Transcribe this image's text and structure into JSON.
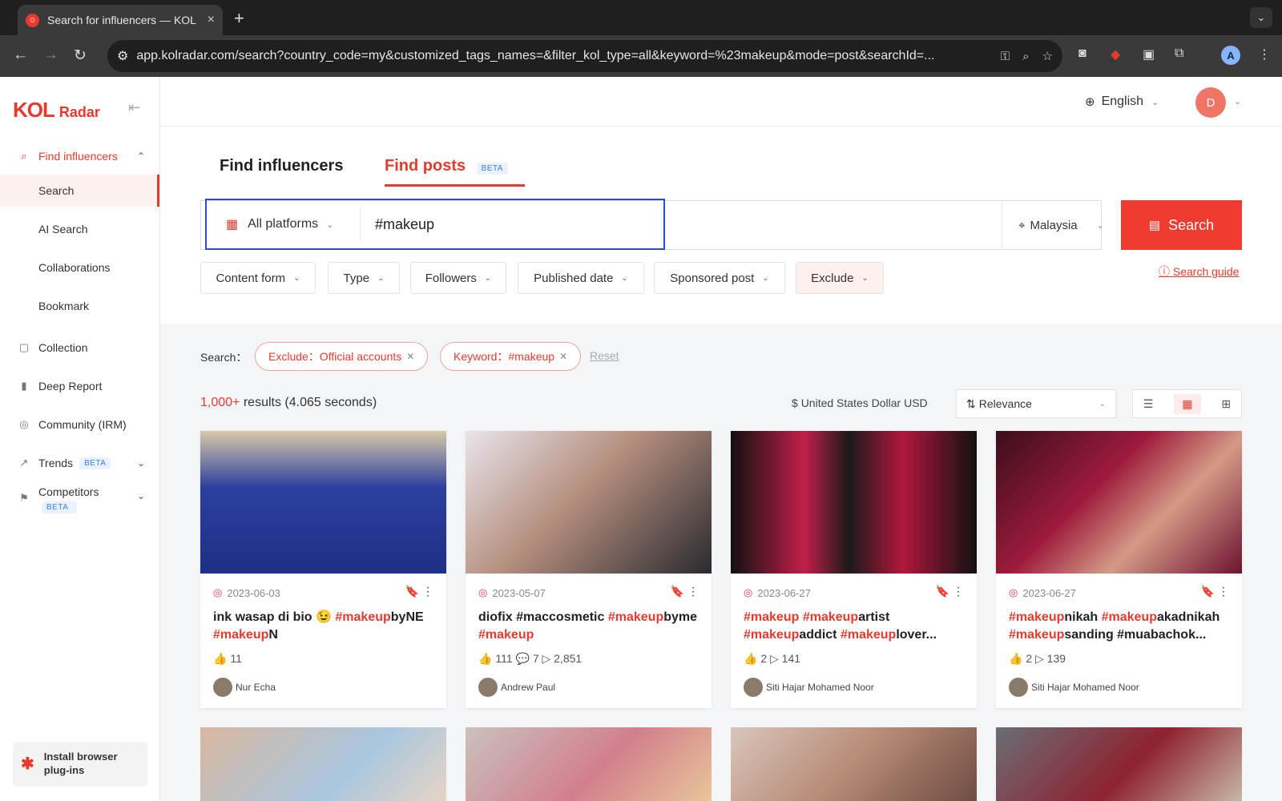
{
  "browser": {
    "tab_title": "Search for influencers — KOL",
    "url": "app.kolradar.com/search?country_code=my&customized_tags_names=&filter_kol_type=all&keyword=%23makeup&mode=post&searchId=..."
  },
  "sidebar": {
    "logo_main": "KOL",
    "logo_sub": "Radar",
    "items": [
      {
        "label": "Find influencers",
        "icon": "search-icon"
      },
      {
        "label": "Search"
      },
      {
        "label": "AI Search"
      },
      {
        "label": "Collaborations"
      },
      {
        "label": "Bookmark"
      },
      {
        "label": "Collection",
        "icon": "collection-icon"
      },
      {
        "label": "Deep Report",
        "icon": "chart-icon"
      },
      {
        "label": "Community (IRM)",
        "icon": "community-icon"
      },
      {
        "label": "Trends",
        "icon": "trend-icon",
        "badge": "BETA"
      },
      {
        "label": "Competitors",
        "icon": "flag-icon",
        "badge": "BETA"
      }
    ],
    "plugin_label_1": "Install browser",
    "plugin_label_2": "plug-ins"
  },
  "header": {
    "language": "English",
    "avatar_initial": "D"
  },
  "search": {
    "tab_influencers": "Find influencers",
    "tab_posts": "Find posts",
    "tab_posts_badge": "BETA",
    "platform": "All platforms",
    "keyword": "#makeup",
    "country": "Malaysia",
    "button": "Search",
    "filters": [
      "Content form",
      "Type",
      "Followers",
      "Published date",
      "Sponsored post",
      "Exclude"
    ],
    "guide": "Search guide"
  },
  "results": {
    "chips_label": "Search：",
    "chips": [
      "Exclude：Official accounts",
      "Keyword：#makeup"
    ],
    "reset": "Reset",
    "count": "1,000+",
    "count_suffix": " results (4.065 seconds)",
    "currency": "United States Dollar USD",
    "sort": "Relevance"
  },
  "posts": [
    {
      "date": "2023-06-03",
      "caption": "ink wasap di bio 😉 #makeupbyNE #makeupN",
      "stats": "👍 11",
      "author": "Nur Echa"
    },
    {
      "date": "2023-05-07",
      "caption": "diofix #maccosmetic #makeupbyme #makeup",
      "stats": "👍 111  💬 7  ▷ 2,851",
      "author": "Andrew Paul"
    },
    {
      "date": "2023-06-27",
      "caption": "#makeup #makeupartist #makeupaddict #makeuplover...",
      "stats": "👍 2  ▷ 141",
      "author": "Siti Hajar Mohamed Noor"
    },
    {
      "date": "2023-06-27",
      "caption": "#makeupnikah #makeupakadnikah #makeupsanding #muabachok...",
      "stats": "👍 2  ▷ 139",
      "author": "Siti Hajar Mohamed Noor"
    }
  ],
  "colors": {
    "accent": "#e8392d",
    "focus": "#2a4bd8"
  }
}
